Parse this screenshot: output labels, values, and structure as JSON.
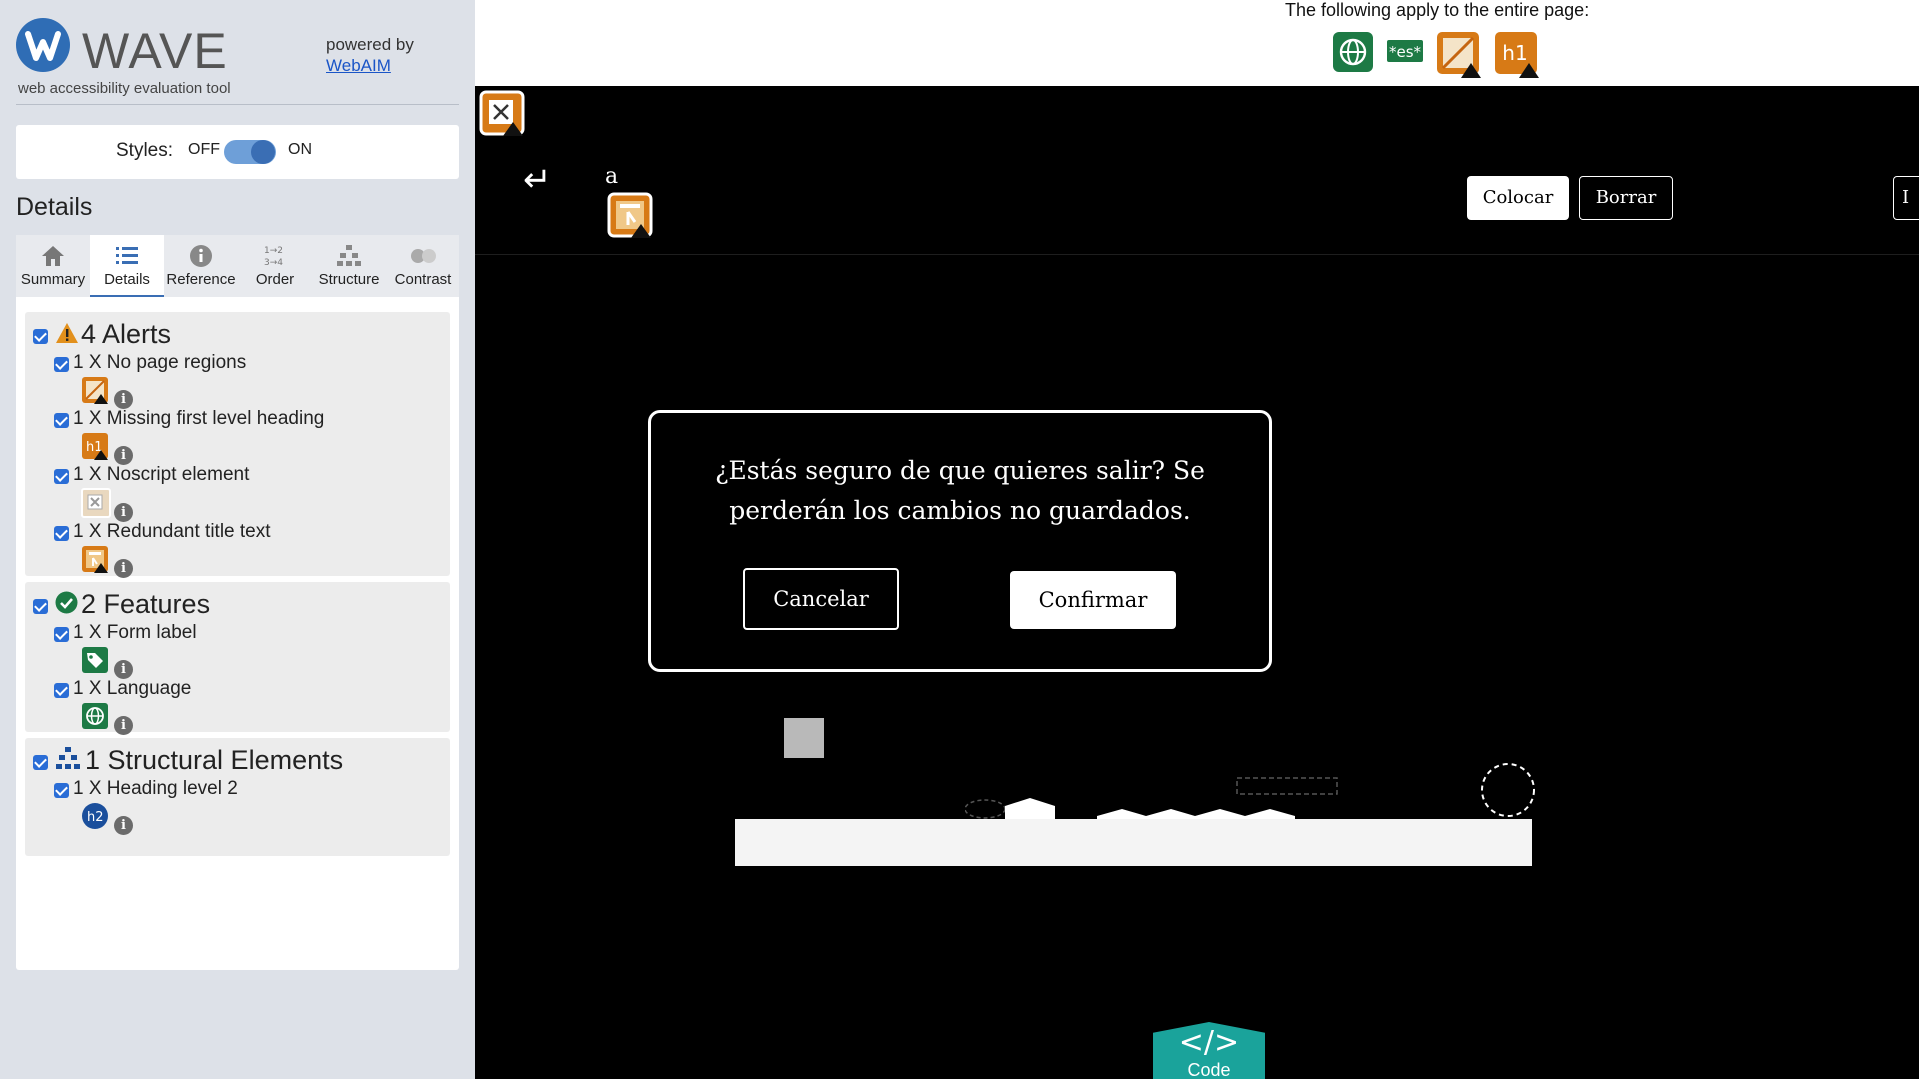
{
  "sidebar": {
    "logo_text": "WAVE",
    "subtitle": "web accessibility evaluation tool",
    "powered_by": "powered by",
    "webaim_link": "WebAIM",
    "styles": {
      "label": "Styles:",
      "off": "OFF",
      "on": "ON",
      "state": "on"
    },
    "details_heading": "Details",
    "tabs": [
      {
        "label": "Summary",
        "icon": "home-icon"
      },
      {
        "label": "Details",
        "icon": "list-icon",
        "active": true
      },
      {
        "label": "Reference",
        "icon": "info-icon"
      },
      {
        "label": "Order",
        "icon": "order-icon"
      },
      {
        "label": "Structure",
        "icon": "structure-icon"
      },
      {
        "label": "Contrast",
        "icon": "contrast-icon"
      }
    ],
    "groups": {
      "alerts": {
        "title": "4 Alerts",
        "items": [
          {
            "label": "1 X No page regions"
          },
          {
            "label": "1 X Missing first level heading",
            "badge": "h1"
          },
          {
            "label": "1 X Noscript element"
          },
          {
            "label": "1 X Redundant title text"
          }
        ]
      },
      "features": {
        "title": "2 Features",
        "items": [
          {
            "label": "1 X Form label"
          },
          {
            "label": "1 X Language"
          }
        ]
      },
      "structure": {
        "title": "1 Structural Elements",
        "items": [
          {
            "label": "1 X Heading level 2",
            "badge": "h2"
          }
        ]
      }
    }
  },
  "page": {
    "topbar": {
      "text": "The following apply to the entire page:",
      "lang_badge": "*es*",
      "h1_badge": "h1"
    },
    "small_text": "a",
    "buttons": {
      "place": "Colocar",
      "erase": "Borrar",
      "partial": "I"
    },
    "modal": {
      "message": "¿Estás seguro de que quieres salir? Se perderán los cambios no guardados.",
      "cancel": "Cancelar",
      "confirm": "Confirmar"
    },
    "code_button": {
      "symbol": "</>",
      "label": "Code"
    }
  },
  "colors": {
    "wave_blue": "#2f6db5",
    "alert_orange": "#d77a16",
    "feature_green": "#1d7a45",
    "structure_blue": "#1b4f9c",
    "code_teal": "#1aa39b"
  }
}
